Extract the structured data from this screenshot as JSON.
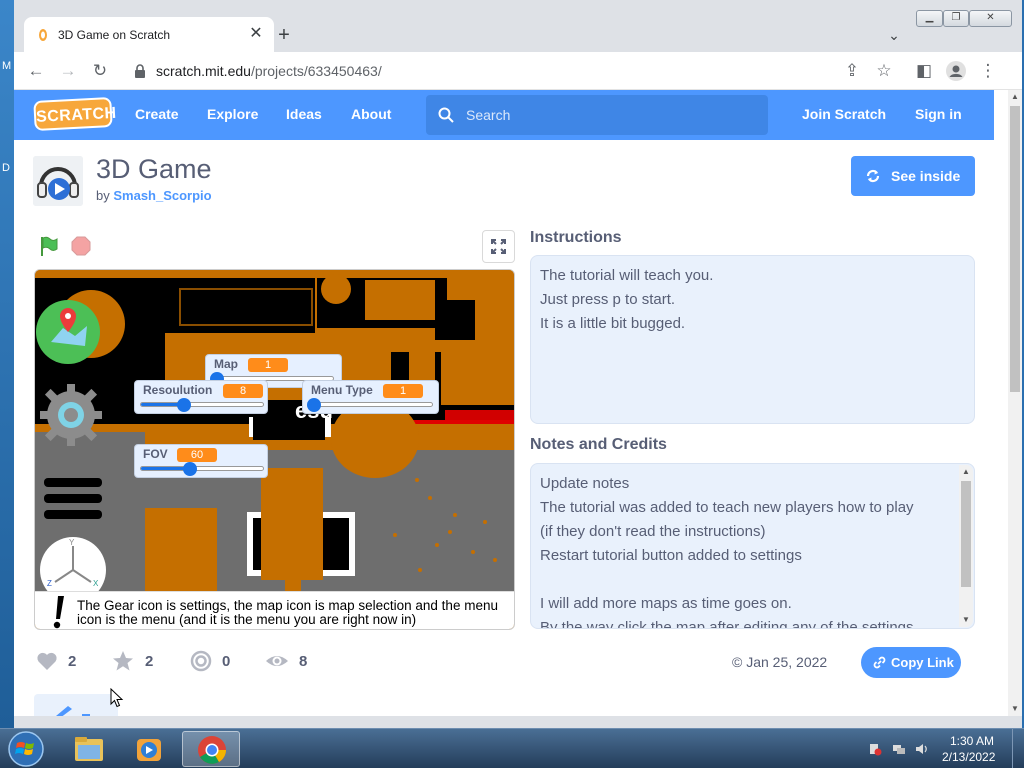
{
  "desktop": {
    "letters": [
      "M",
      "D"
    ]
  },
  "browser": {
    "tab_title": "3D Game on Scratch",
    "url_host": "scratch.mit.edu",
    "url_path": "/projects/633450463/",
    "icons": [
      "back-icon",
      "forward-icon",
      "reload-icon",
      "lock-icon",
      "share-icon",
      "star-icon",
      "side-panel-icon",
      "profile-icon",
      "more-icon"
    ]
  },
  "nav": {
    "logo": "SCRATCH",
    "create": "Create",
    "explore": "Explore",
    "ideas": "Ideas",
    "about": "About",
    "search_placeholder": "Search",
    "join": "Join Scratch",
    "signin": "Sign in"
  },
  "project": {
    "title": "3D Game",
    "by": "by",
    "author": "Smash_Scorpio",
    "see_inside": "See inside"
  },
  "stage": {
    "monitors": [
      {
        "label": "Map",
        "value": "1"
      },
      {
        "label": "Resoulution",
        "value": "8"
      },
      {
        "label": "Menu Type",
        "value": "1"
      },
      {
        "label": "FOV",
        "value": "60"
      }
    ],
    "center_text": "esu",
    "caption": "The Gear icon is settings, the map icon is map selection and the menu icon is the menu (and it is the menu you are right now in)"
  },
  "instructions": {
    "title": "Instructions",
    "lines": [
      "The tutorial will teach you.",
      "Just press p to start.",
      "It is a little bit bugged."
    ]
  },
  "notes": {
    "title": "Notes and Credits",
    "lines": [
      "Update notes",
      "The tutorial was added to teach new players how to play",
      "(if they don't read the instructions)",
      "Restart tutorial button added to settings",
      "",
      "I will add more maps as time goes on.",
      "By the way click the map after editing any of the settings"
    ]
  },
  "stats": {
    "loves": "2",
    "favorites": "2",
    "remixes": "0",
    "views": "8",
    "date": "Jan 25, 2022",
    "copy_link": "Copy Link"
  },
  "taskbar": {
    "time": "1:30 AM",
    "date": "2/13/2022"
  },
  "colors": {
    "scratch_blue": "#4d97ff",
    "orange": "#ff8c1a",
    "text_gray": "#575e75"
  }
}
